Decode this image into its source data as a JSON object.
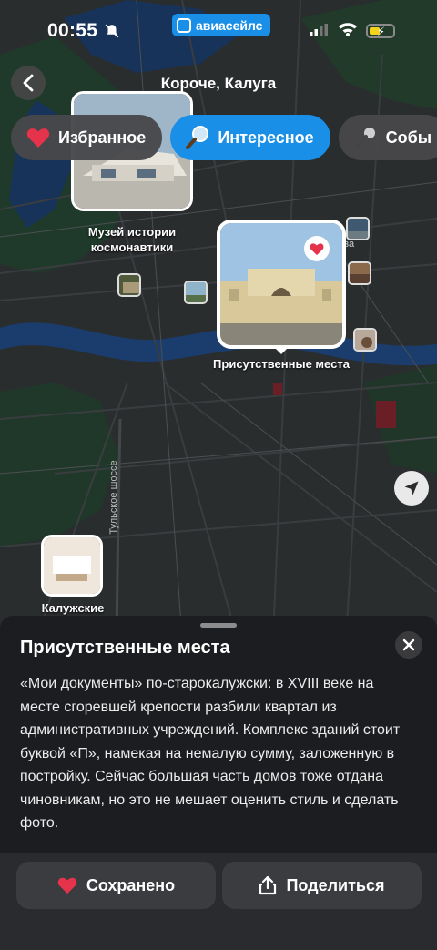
{
  "status_bar": {
    "time": "00:55",
    "app_badge": "авиасейлс"
  },
  "header": {
    "title": "Короче, Калуга"
  },
  "chips": [
    {
      "label": "Избранное",
      "icon": "heart-icon",
      "active": false
    },
    {
      "label": "Интересное",
      "icon": "magnifier-icon",
      "active": true
    },
    {
      "label": "Собы",
      "icon": "microphone-icon",
      "active": false
    }
  ],
  "map": {
    "road_label": "Тульское шоссе",
    "markers": [
      {
        "label": "Музей истории космонавтики"
      },
      {
        "label": "Присутственные места",
        "favorite": true
      },
      {
        "label": "Калужские"
      }
    ],
    "fragment_label": "за"
  },
  "sheet": {
    "title": "Присутственные места",
    "description": "«Мои документы» по-старокалужски: в XVIII веке на месте сгоревшей крепости разбили квартал из административных учреждений. Комплекс зданий стоит буквой «П», намекая на немалую сумму, заложенную в постройку. Сейчас большая часть домов тоже отдана чиновникам, но это не мешает оценить стиль и сделать фото."
  },
  "actions": {
    "saved_label": "Сохранено",
    "share_label": "Поделиться"
  },
  "colors": {
    "accent": "#1a8fe8",
    "heart": "#e5334b",
    "sheet_bg": "#1c1d20"
  }
}
